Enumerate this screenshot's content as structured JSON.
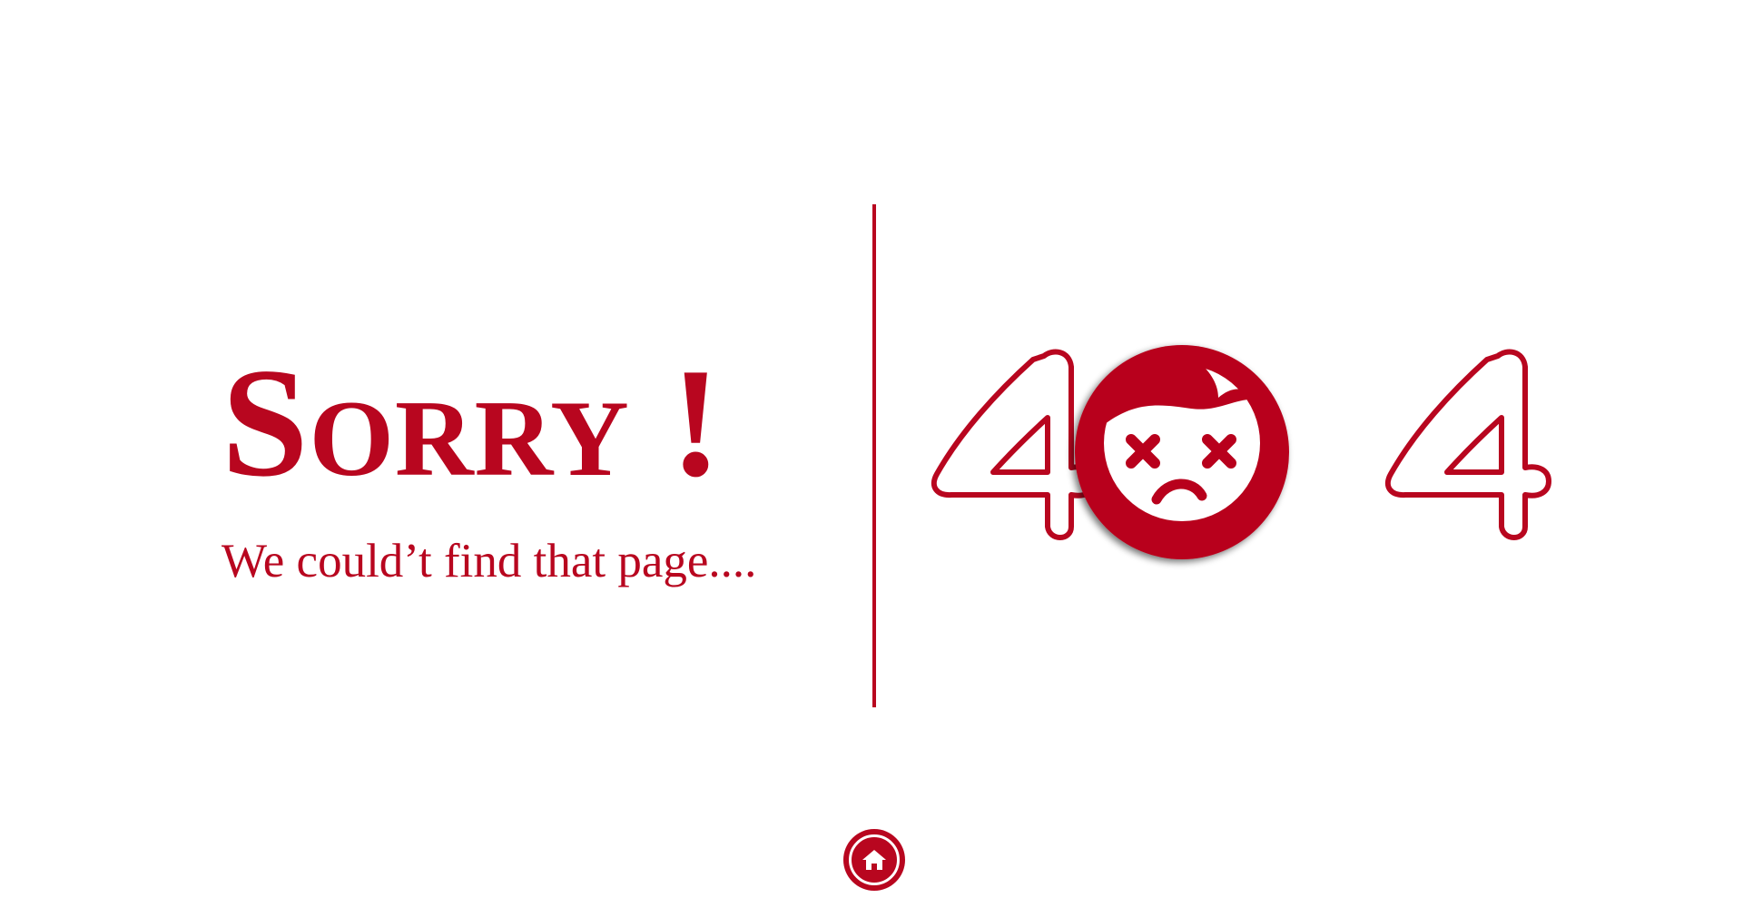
{
  "main": {
    "heading": "Sorry !",
    "subtitle": "We could’t find that page....",
    "error_code": "404"
  },
  "footer": {
    "home_icon": "home-icon"
  },
  "colors": {
    "accent": "#b8061f",
    "background": "#ffffff"
  }
}
